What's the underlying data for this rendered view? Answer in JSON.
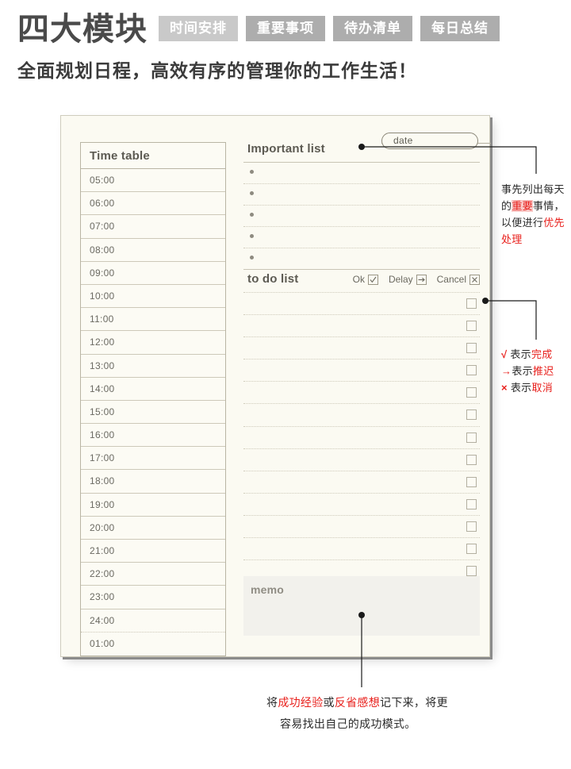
{
  "header": {
    "title": "四大模块",
    "tags": [
      {
        "label": "时间安排",
        "color": "#c9c9c9"
      },
      {
        "label": "重要事项",
        "color": "#adadad"
      },
      {
        "label": "待办清单",
        "color": "#adadad"
      },
      {
        "label": "每日总结",
        "color": "#adadad"
      }
    ],
    "subtitle": "全面规划日程，高效有序的管理你的工作生活！"
  },
  "planner": {
    "timetable": {
      "title": "Time table",
      "rows": [
        "05:00",
        "06:00",
        "07:00",
        "08:00",
        "09:00",
        "10:00",
        "11:00",
        "12:00",
        "13:00",
        "14:00",
        "15:00",
        "16:00",
        "17:00",
        "18:00",
        "19:00",
        "20:00",
        "21:00",
        "22:00",
        "23:00",
        "24:00",
        "01:00"
      ]
    },
    "date_field": {
      "label": "date",
      "value": ""
    },
    "important_list": {
      "title": "Important list",
      "bullet_count": 5
    },
    "todo_list": {
      "title": "to do list",
      "legend": [
        {
          "label": "Ok",
          "icon": "checkbox-check-icon"
        },
        {
          "label": "Delay",
          "icon": "checkbox-arrow-icon"
        },
        {
          "label": "Cancel",
          "icon": "checkbox-cross-icon"
        }
      ],
      "row_count": 13
    },
    "memo": {
      "label": "memo",
      "value": ""
    }
  },
  "annotations": {
    "important": {
      "seg1": "事先列出每天的",
      "seg2_highlight": "重要",
      "seg3": "事情，以便进行",
      "seg4_red": "优先处理"
    },
    "todo": {
      "lines": [
        {
          "symbol": "√",
          "prefix": "表示",
          "keyword": "完成"
        },
        {
          "symbol": "→",
          "prefix": "表示",
          "keyword": "推迟"
        },
        {
          "symbol": "×",
          "prefix": "表示",
          "keyword": "取消"
        }
      ]
    },
    "memo": {
      "seg1": "将",
      "seg2_red": "成功经验",
      "seg3": "或",
      "seg4_red": "反省感想",
      "seg5": "记下来，将更",
      "line2": "容易找出自己的成功模式。"
    }
  },
  "colors": {
    "card_bg": "#fbfaf2",
    "accent_red": "#e8201c",
    "tag_grey": "#adadad",
    "memo_bg": "#f2f1ec"
  }
}
